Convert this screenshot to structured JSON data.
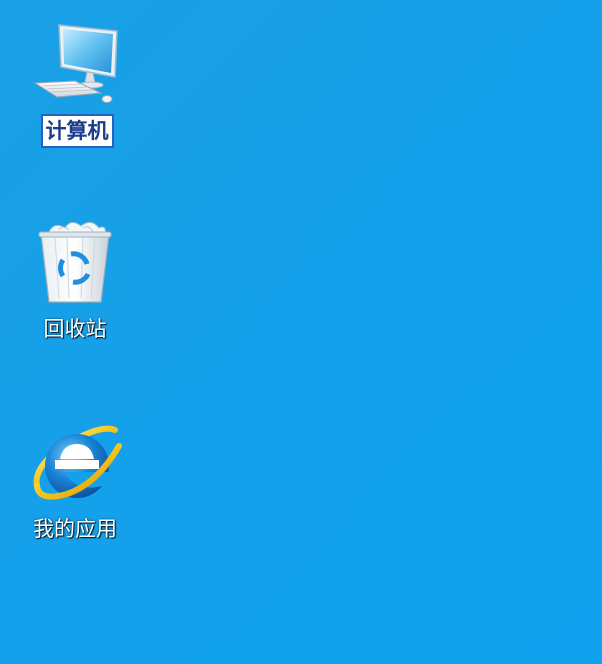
{
  "desktop": {
    "background_color": "#16a1e9",
    "icons": [
      {
        "label": "计算机",
        "icon": "computer-icon",
        "selected": true
      },
      {
        "label": "回收站",
        "icon": "recycle-bin-icon",
        "selected": false
      },
      {
        "label": "我的应用",
        "icon": "internet-explorer-icon",
        "selected": false
      }
    ]
  }
}
